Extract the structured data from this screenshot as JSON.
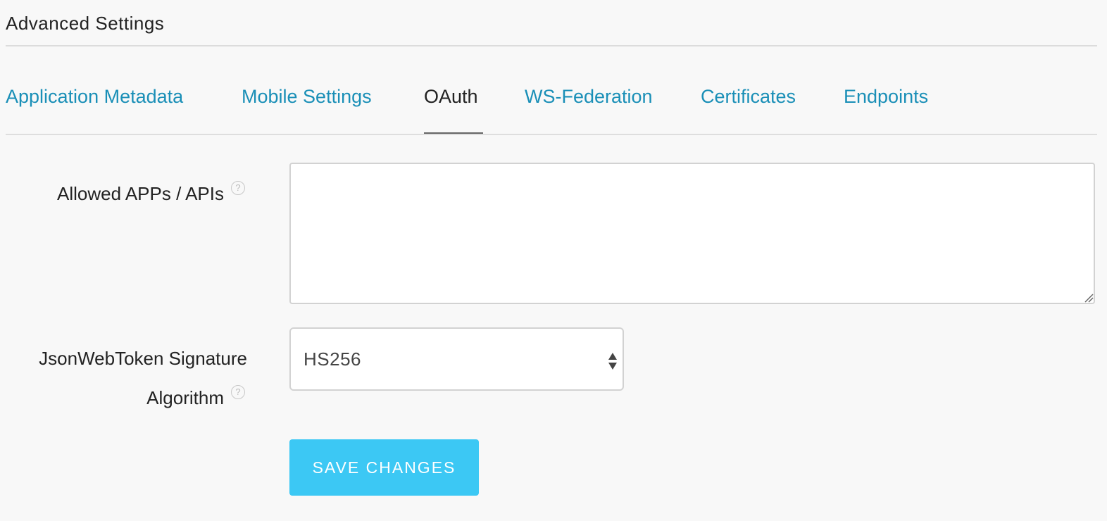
{
  "section": {
    "title": "Advanced Settings"
  },
  "tabs": [
    {
      "label": "Application Metadata",
      "active": false
    },
    {
      "label": "Mobile Settings",
      "active": false
    },
    {
      "label": "OAuth",
      "active": true
    },
    {
      "label": "WS-Federation",
      "active": false
    },
    {
      "label": "Certificates",
      "active": false
    },
    {
      "label": "Endpoints",
      "active": false
    }
  ],
  "form": {
    "allowed_apps": {
      "label": "Allowed APPs / APIs",
      "value": "",
      "help_icon": "question-circle-icon"
    },
    "jwt_algorithm": {
      "label_line1": "JsonWebToken Signature",
      "label_line2": "Algorithm",
      "selected": "HS256",
      "help_icon": "question-circle-icon"
    },
    "save_label": "SAVE CHANGES"
  },
  "colors": {
    "link": "#1a8fb7",
    "button": "#3cc8f4",
    "background": "#f8f8f8"
  }
}
